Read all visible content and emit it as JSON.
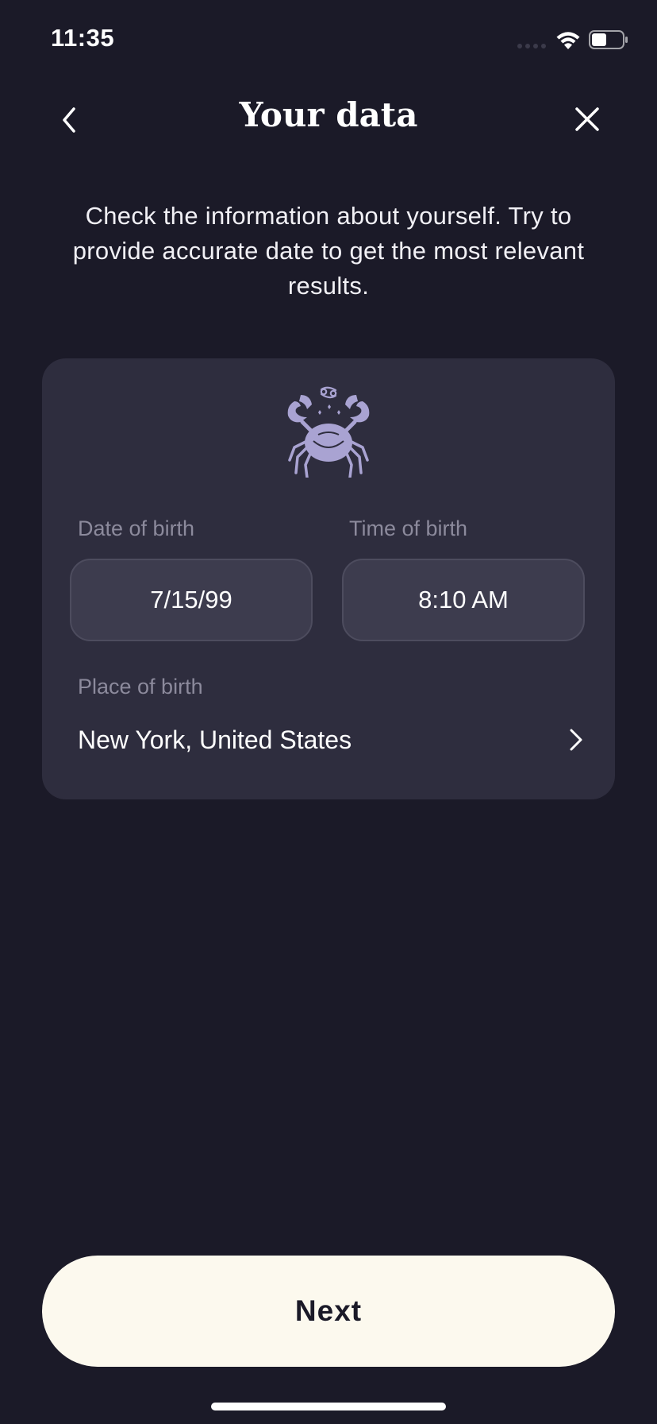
{
  "status_bar": {
    "time": "11:35",
    "icons": [
      "wifi-icon",
      "battery-icon"
    ]
  },
  "header": {
    "title": "Your data",
    "back_icon": "chevron-left-icon",
    "close_icon": "close-icon"
  },
  "intro": {
    "text": "Check the information about yourself. Try to provide accurate date to get  the most relevant results."
  },
  "card": {
    "zodiac_icon": "cancer-crab-icon",
    "date_of_birth": {
      "label": "Date of birth",
      "value": "7/15/99"
    },
    "time_of_birth": {
      "label": "Time of birth",
      "value": "8:10 AM"
    },
    "place_of_birth": {
      "label": "Place of birth",
      "value": "New York, United States"
    }
  },
  "footer": {
    "next_label": "Next"
  },
  "colors": {
    "background": "#1b1a28",
    "card": "#2e2d3e",
    "field": "#3d3c4e",
    "accent": "#a9a3d2",
    "button": "#fcf9ee"
  }
}
